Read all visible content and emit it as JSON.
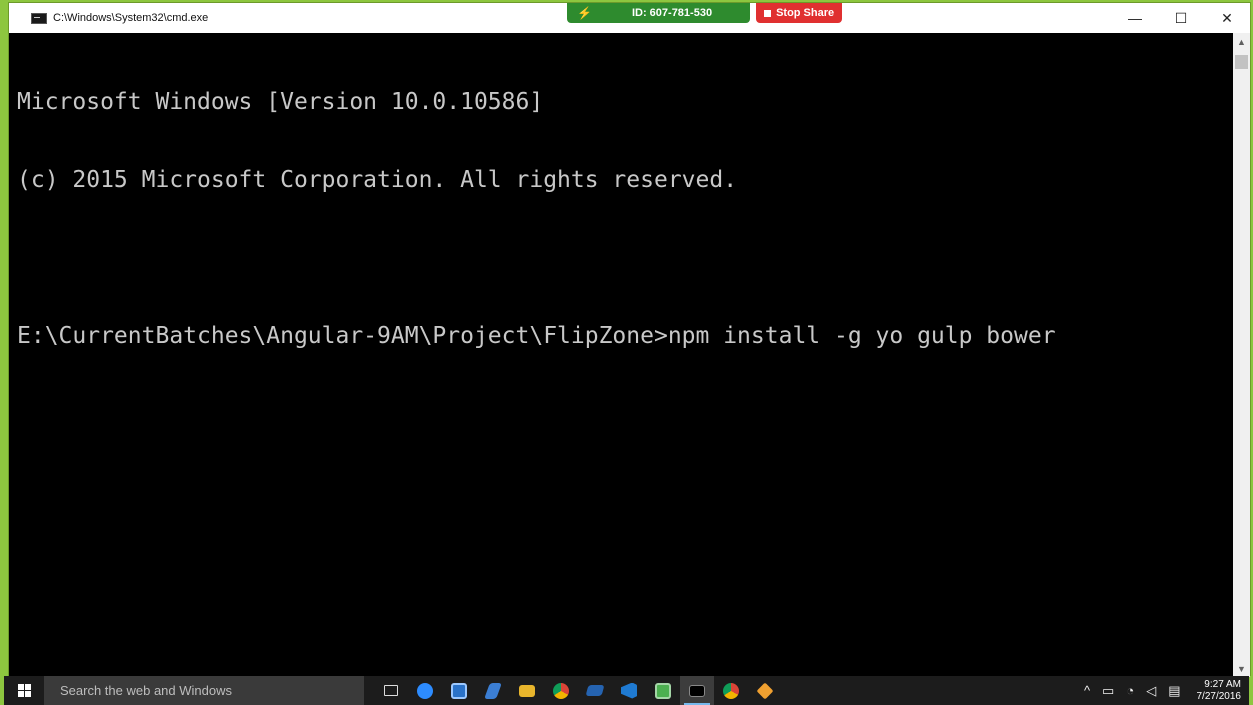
{
  "window": {
    "title": "C:\\Windows\\System32\\cmd.exe",
    "controls": {
      "minimize": "—",
      "maximize": "☐",
      "close": "✕"
    }
  },
  "share_bar": {
    "id_text": "ID: 607-781-530",
    "stop_label": "Stop Share"
  },
  "console": {
    "lines": [
      "Microsoft Windows [Version 10.0.10586]",
      "(c) 2015 Microsoft Corporation. All rights reserved.",
      "",
      "E:\\CurrentBatches\\Angular-9AM\\Project\\FlipZone>npm install -g yo gulp bower"
    ]
  },
  "taskbar": {
    "search_placeholder": "Search the web and Windows",
    "apps": [
      "task-view",
      "zoom",
      "app-square",
      "pen-app",
      "file-explorer",
      "chrome",
      "blue-app",
      "visual-studio-code",
      "photos",
      "command-prompt",
      "chrome",
      "git"
    ],
    "tray": {
      "chevron": "^",
      "clock_time": "9:27 AM",
      "clock_date": "7/27/2016"
    }
  },
  "colors": {
    "share_border": "#8dc63f",
    "console_bg": "#000000",
    "console_text": "#c8c8c8",
    "stop_red": "#e03030",
    "share_green": "#2e8b2e"
  }
}
